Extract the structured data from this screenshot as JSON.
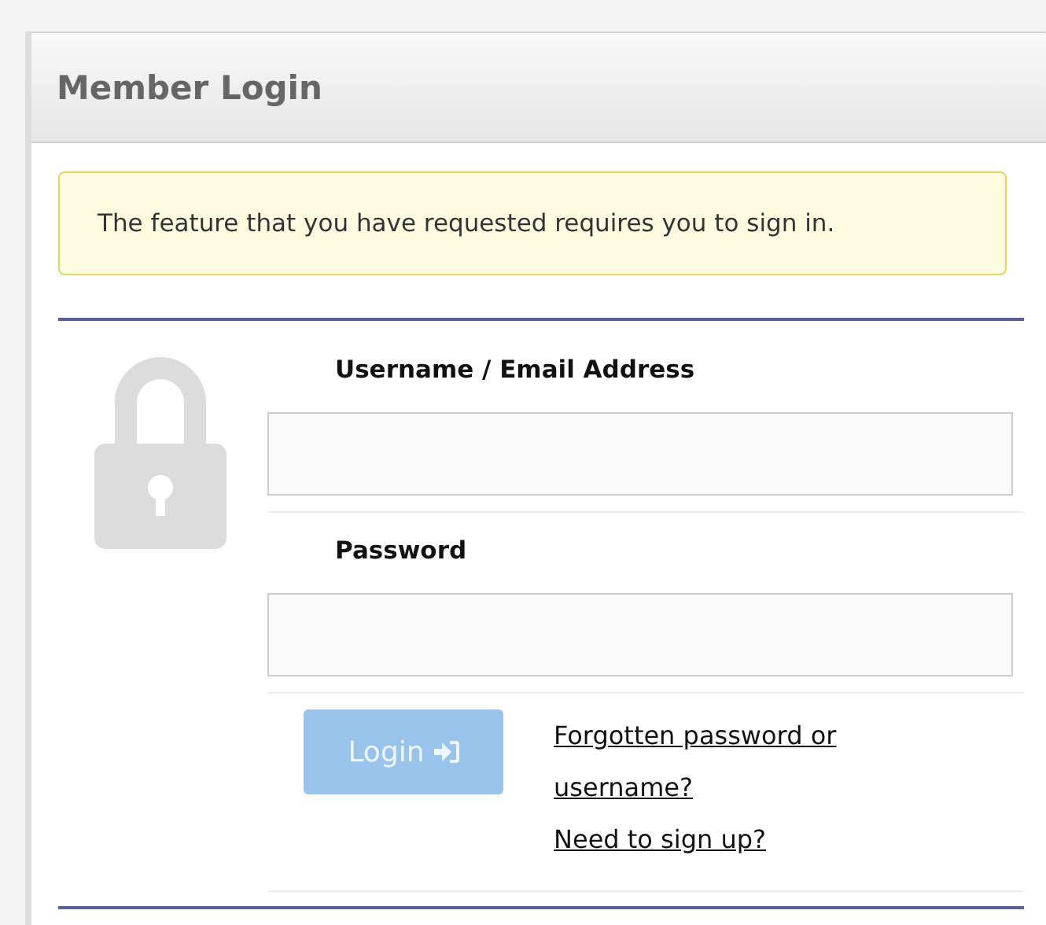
{
  "panel": {
    "title": "Member Login"
  },
  "notice": "The feature that you have requested requires you to sign in.",
  "fields": [
    {
      "label": "Username / Email Address"
    },
    {
      "label": "Password"
    }
  ],
  "login_button": {
    "label": "Login",
    "disabled": true
  },
  "links": [
    "Forgotten password or username?",
    "Need to sign up?"
  ]
}
